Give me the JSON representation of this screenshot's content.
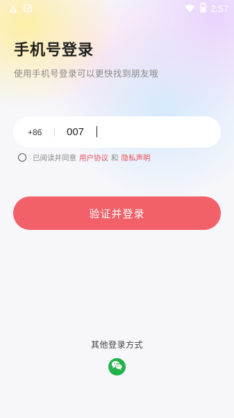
{
  "status_bar": {
    "time": "2:57",
    "icons": [
      "notification-icon",
      "app-notification-icon",
      "wifi-icon",
      "battery-icon"
    ]
  },
  "login": {
    "title": "手机号登录",
    "subtitle": "使用手机号登录可以更快找到朋友哦",
    "country_code": "+86",
    "phone_value": "007",
    "agreement": {
      "prefix": "已阅读并同意",
      "user_agreement": "用户协议",
      "and": "和",
      "privacy_statement": "隐私声明"
    },
    "submit_label": "验证并登录",
    "other_methods_label": "其他登录方式",
    "other_methods": [
      "wechat-icon"
    ]
  },
  "colors": {
    "accent": "#f2606a",
    "link": "#e8505b",
    "wechat": "#21b34a"
  }
}
